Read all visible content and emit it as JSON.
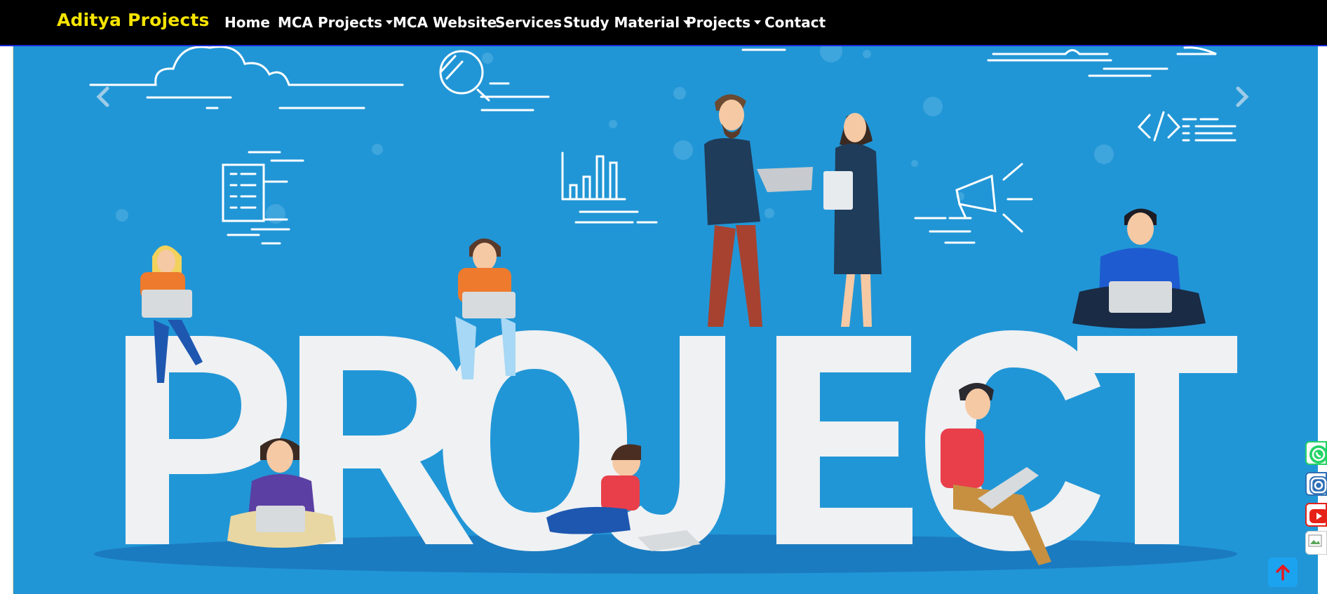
{
  "brand": {
    "name": "Aditya Projects"
  },
  "nav": {
    "items": [
      {
        "label": "Home",
        "dropdown": false
      },
      {
        "label": "MCA Projects",
        "dropdown": true
      },
      {
        "label": "MCA Website",
        "dropdown": false
      },
      {
        "label": "Services",
        "dropdown": false
      },
      {
        "label": "Study Material",
        "dropdown": true
      },
      {
        "label": "Projects",
        "dropdown": true
      },
      {
        "label": "Contact",
        "dropdown": false
      }
    ]
  },
  "hero": {
    "headline": "PROJECT",
    "controls": {
      "prev_icon": "chevron-left-icon",
      "next_icon": "chevron-right-icon"
    }
  },
  "social": [
    "whatsapp-icon",
    "instagram-icon",
    "youtube-icon",
    "broken-image-icon"
  ],
  "back_to_top": {
    "icon": "arrow-up-icon"
  },
  "colors": {
    "navbar_bg": "#000000",
    "brand": "#f5e400",
    "hero_bg": "#2196d6",
    "headline": "#eff1f3",
    "back_to_top": "#1ca3f0"
  }
}
